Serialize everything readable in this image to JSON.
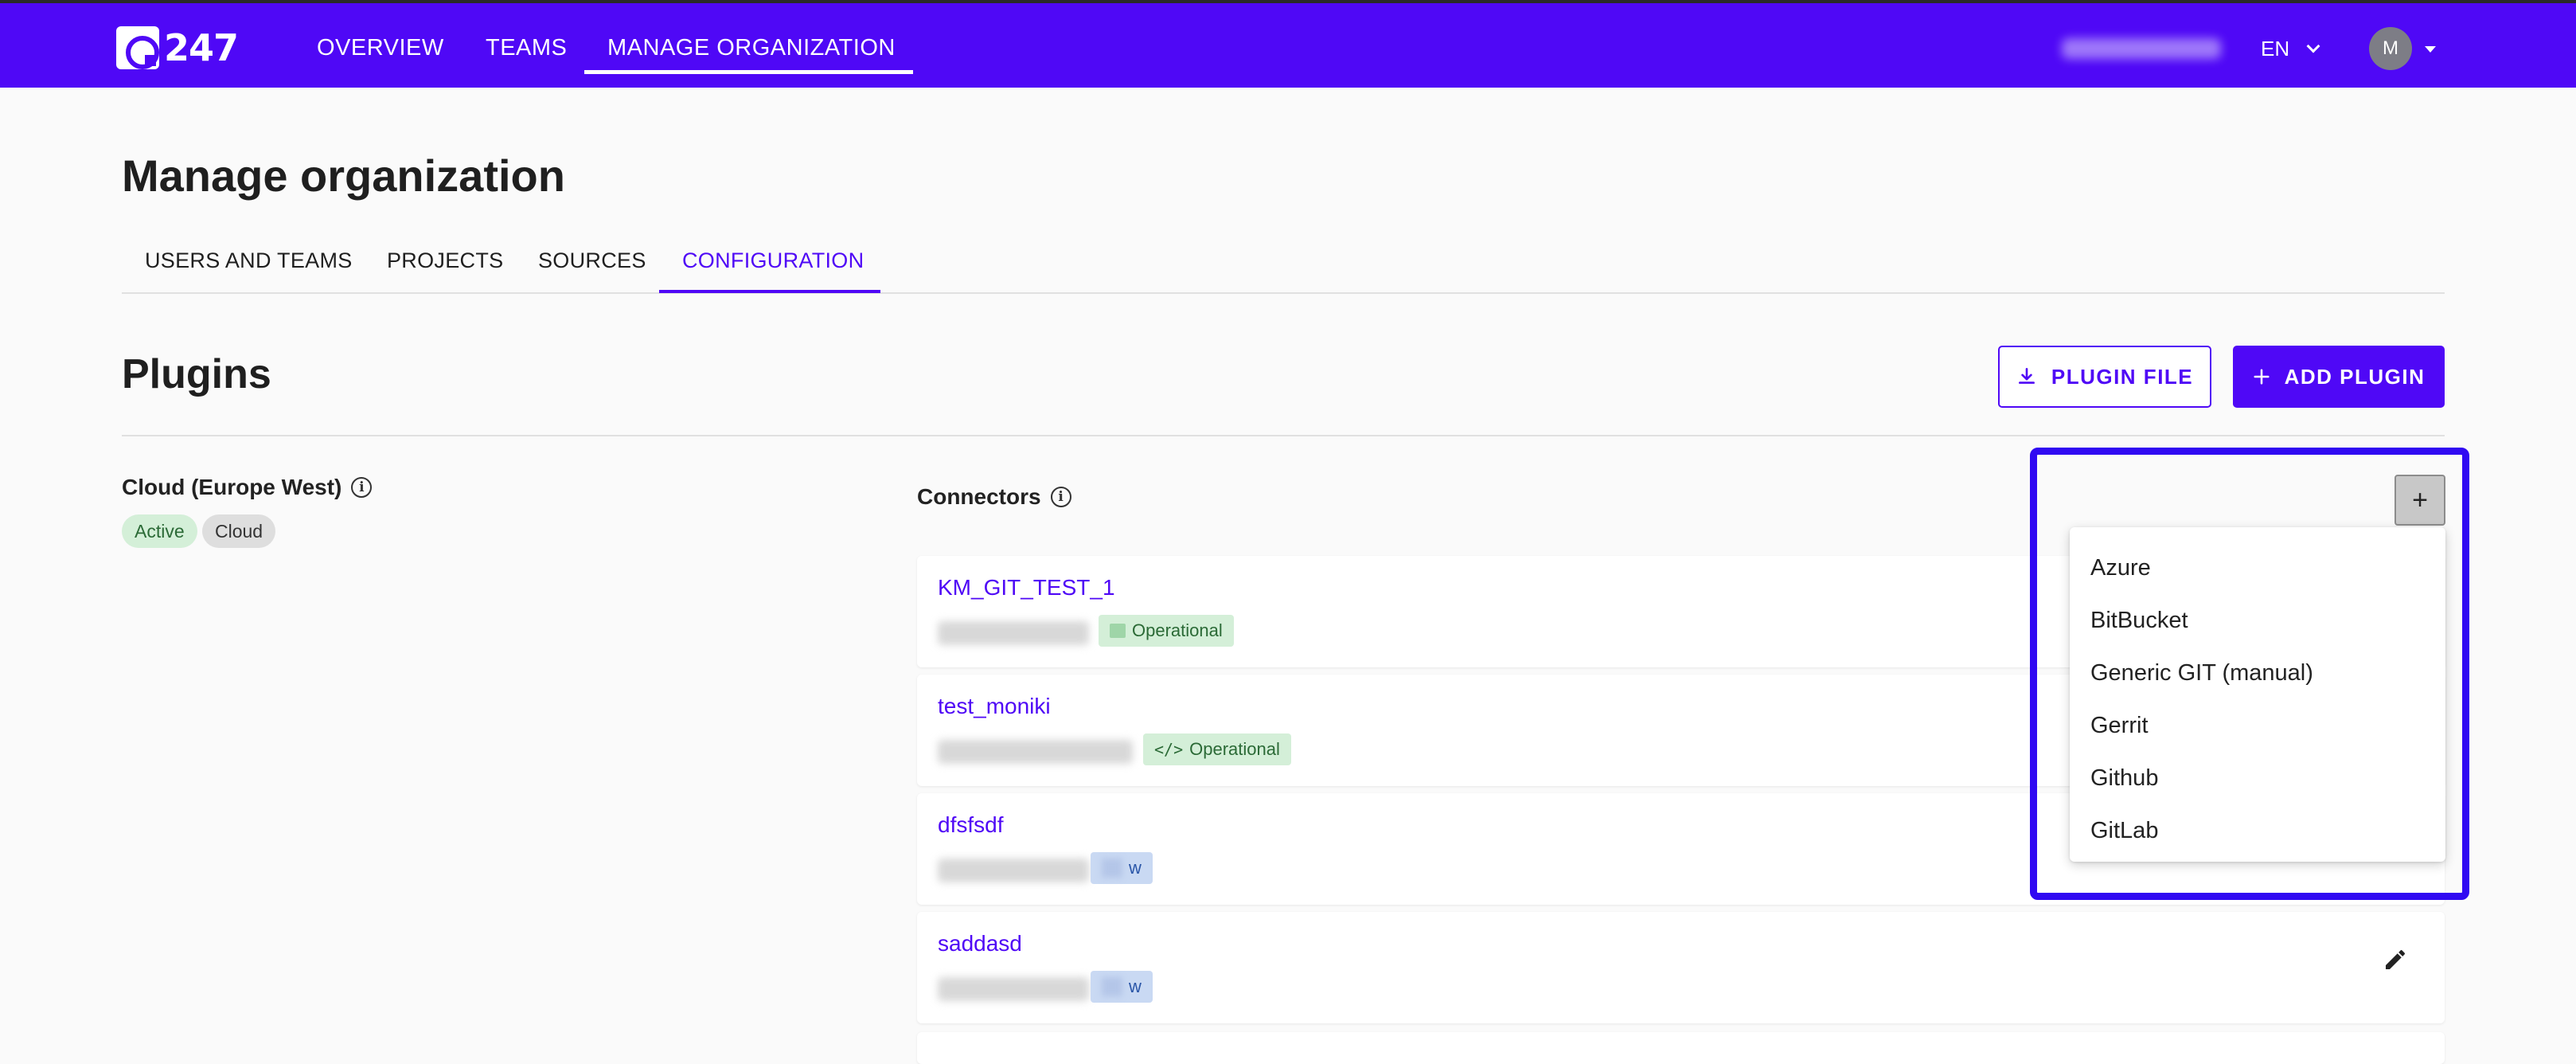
{
  "topbar": {
    "logo_text": "247",
    "nav": [
      "OVERVIEW",
      "TEAMS",
      "MANAGE ORGANIZATION"
    ],
    "language": "EN",
    "avatar_initial": "M",
    "accent_color": "#4f08f6"
  },
  "page": {
    "title": "Manage organization",
    "tabs": [
      "USERS AND TEAMS",
      "PROJECTS",
      "SOURCES",
      "CONFIGURATION"
    ],
    "active_tab": "CONFIGURATION"
  },
  "plugins": {
    "title": "Plugins",
    "plugin_file_label": "PLUGIN FILE",
    "add_plugin_label": "ADD PLUGIN"
  },
  "cloud": {
    "title": "Cloud (Europe West)",
    "chips": [
      "Active",
      "Cloud"
    ]
  },
  "connectors": {
    "title": "Connectors",
    "add_icon": "+",
    "items": [
      {
        "name": "KM_GIT_TEST_1",
        "badge": "Operational"
      },
      {
        "name": "test_moniki",
        "badge": "Operational"
      },
      {
        "name": "dfsfsdf",
        "badge": "w"
      },
      {
        "name": "saddasd",
        "badge": "w"
      }
    ],
    "dropdown_options": [
      "Azure",
      "BitBucket",
      "Generic GIT (manual)",
      "Gerrit",
      "Github",
      "GitLab"
    ]
  }
}
